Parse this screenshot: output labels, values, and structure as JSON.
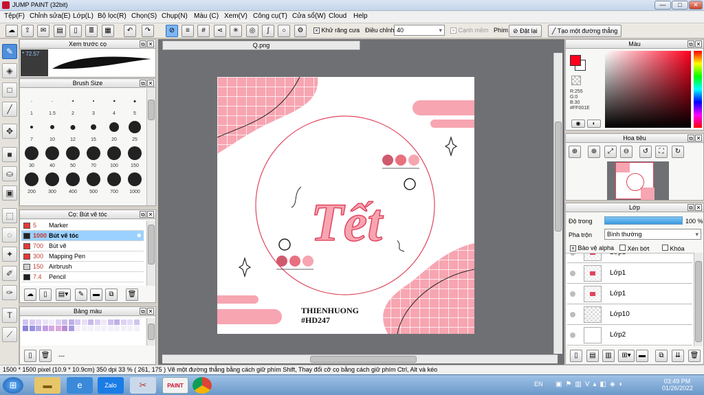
{
  "app": {
    "title": "JUMP PAINT (32bit)",
    "min": "—",
    "max": "□",
    "close": "✕"
  },
  "menu": [
    "Tệp(F)",
    "Chỉnh sửa(E)",
    "Lớp(L)",
    "Bộ lọc(R)",
    "Chọn(S)",
    "Chụp(N)",
    "Màu (C)",
    "Xem(V)",
    "Công cụ(T)",
    "Cửa sổ(W)",
    "Cloud",
    "Help"
  ],
  "toolbar": {
    "antialias_label": "Khử răng cưa",
    "adjust_label": "Điều chỉnh",
    "adjust_value": "40",
    "snap_label": "Cạnh mềm",
    "key_label": "Phím",
    "reset_label": "Đặt lại",
    "line_label": "Tạo một đường thẳng"
  },
  "panels": {
    "preview": {
      "title": "Xem trước cọ",
      "zoom": "72.57"
    },
    "brush_size": {
      "title": "Brush Size",
      "sizes": [
        "1",
        "1.5",
        "2",
        "3",
        "4",
        "5",
        "7",
        "10",
        "12",
        "15",
        "20",
        "25",
        "30",
        "40",
        "50",
        "70",
        "100",
        "150",
        "200",
        "300",
        "400",
        "500",
        "700",
        "1000"
      ]
    },
    "brush_list": {
      "title": "Cọ: Bút vẽ tóc",
      "items": [
        {
          "size": "5",
          "name": "Marker",
          "color": "#e53935"
        },
        {
          "size": "1000",
          "name": "Bút vẽ tóc",
          "color": "#222222"
        },
        {
          "size": "700",
          "name": "Bút vẽ",
          "color": "#e53935"
        },
        {
          "size": "300",
          "name": "Mapping Pen",
          "color": "#e53935"
        },
        {
          "size": "150",
          "name": "Airbrush",
          "color": "#d0d0d0"
        },
        {
          "size": "7.4",
          "name": "Pencil",
          "color": "#222222"
        }
      ]
    },
    "palette": {
      "title": "Bảng màu",
      "sep": "---"
    }
  },
  "document": {
    "tab": "Q.png",
    "title_text": "Tết",
    "signature1": "THIENHUONG",
    "signature2": "#HD247"
  },
  "color_panel": {
    "title": "Màu",
    "r": "R:255",
    "g": "G:0",
    "b": "B:30",
    "hex": "#FF001E"
  },
  "navigator": {
    "title": "Hoa tiêu"
  },
  "layer_panel": {
    "title": "Lớp",
    "opacity_label": "Độ trong",
    "opacity_value": "100 %",
    "blend_label": "Pha trộn",
    "blend_value": "Bình thường",
    "protect_alpha": "Bảo vệ alpha",
    "clip": "Xén bớt",
    "lock": "Khóa",
    "layers": [
      {
        "name": "Lớp1"
      },
      {
        "name": "Lớp1"
      },
      {
        "name": "Lớp1"
      },
      {
        "name": "Lớp10"
      },
      {
        "name": "Lớp2"
      }
    ]
  },
  "status": {
    "text": "1500 * 1500 pixel   (10.9 * 10.9cm)   350 dpi   33 %   ( 261, 175 )   Vẽ một đường thẳng bằng cách giữ phím Shift, Thay đổi cỡ cọ bằng cách giữ phím Ctrl, Alt và kéo"
  },
  "taskbar": {
    "lang": "EN",
    "time": "03:49 PM",
    "date": "01/26/2022",
    "zalo": "Zalo",
    "paint": "PAINT"
  },
  "colors": {
    "primary": "#ff001e",
    "pink": "#f4a7b3"
  }
}
